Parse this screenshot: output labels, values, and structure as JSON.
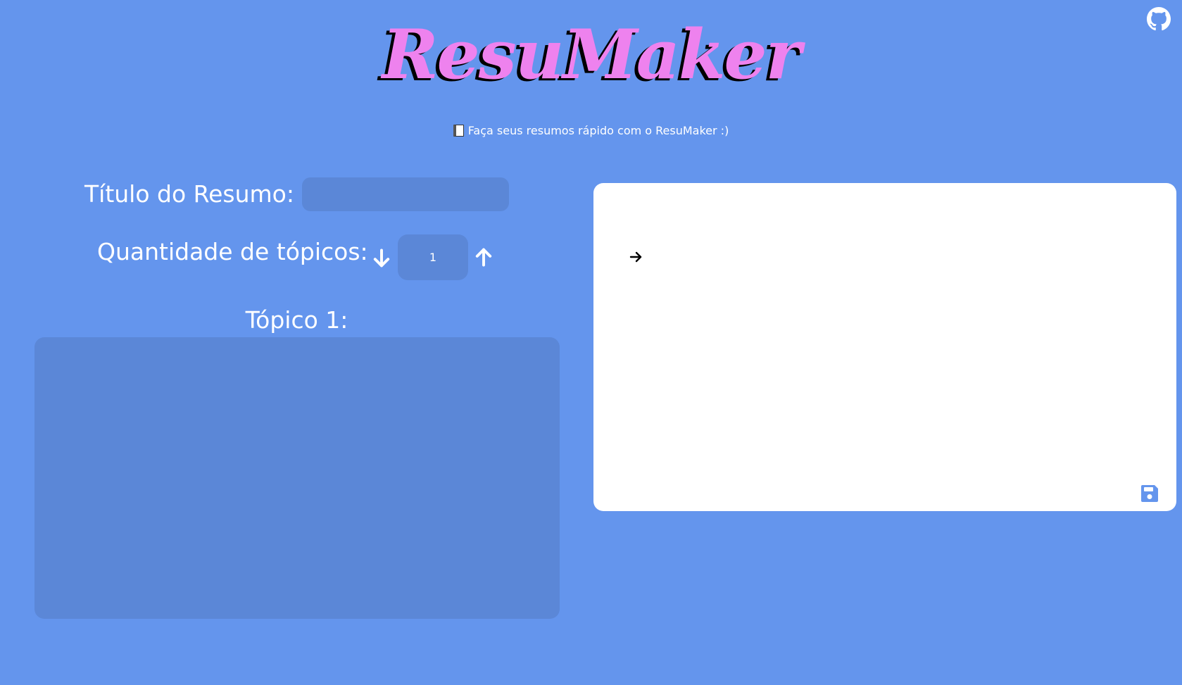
{
  "header": {
    "logo_text": "ResuMaker",
    "tagline": "Faça seus resumos rápido com o ResuMaker :)",
    "tagline_icon": "book-icon",
    "github_icon": "github-icon"
  },
  "form": {
    "title_label": "Título do Resumo:",
    "title_value": "",
    "quantity_label": "Quantidade de tópicos:",
    "quantity_value": "1",
    "decrement_icon": "arrow-down-icon",
    "increment_icon": "arrow-up-icon",
    "topics": [
      {
        "label": "Tópico 1:",
        "value": ""
      }
    ]
  },
  "preview": {
    "bullet_icon": "arrow-right-icon",
    "save_icon": "floppy-disk-icon"
  },
  "colors": {
    "background": "#6495ed",
    "field": "#5b87d7",
    "logo": "#ee82ee",
    "logo_shadow": "#000000",
    "text": "#ffffff",
    "panel": "#ffffff"
  }
}
